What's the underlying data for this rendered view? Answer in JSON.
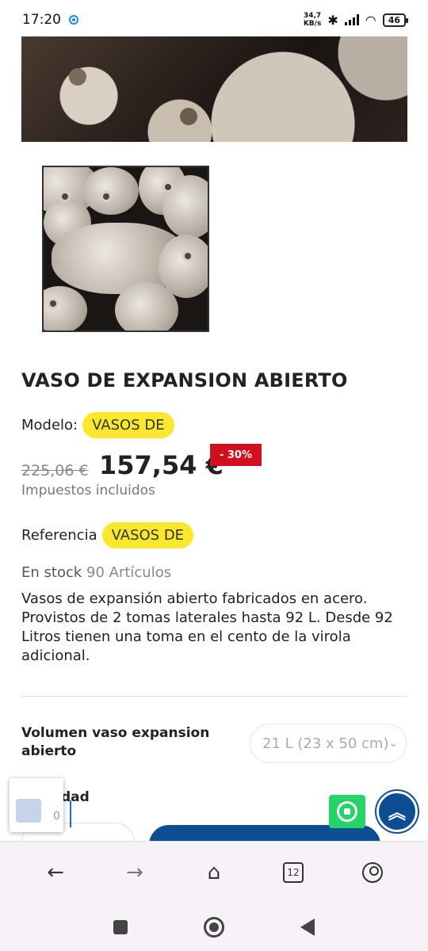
{
  "status_bar": {
    "time": "17:20",
    "net_speed_value": "34,7",
    "net_speed_unit": "KB/s",
    "battery": "46"
  },
  "product": {
    "title": "VASO DE EXPANSION ABIERTO",
    "model_label": "Modelo:",
    "model_value": "VASOS DE",
    "old_price": "225,06 €",
    "new_price": "157,54 €",
    "discount": "- 30%",
    "tax_note": "Impuestos incluidos",
    "reference_label": "Referencia",
    "reference_value": "VASOS DE",
    "stock_label": "En stock",
    "stock_count": "90 Artículos",
    "description": "Vasos de expansión abierto fabricados en acero. Provistos de 2 tomas laterales hasta 92 L. Desde 92 Litros tienen una toma en el cento de la virola adicional.",
    "variant_label": "Volumen vaso expansion abierto",
    "variant_selected": "21 L (23 x 50 cm)",
    "quantity_label": "Cantidad",
    "quantity_value": "0"
  },
  "browser": {
    "tab_count": "12"
  },
  "icons": {
    "back": "back-arrow-icon",
    "forward": "forward-arrow-icon",
    "home": "home-icon",
    "tabs": "tabs-icon",
    "profile": "profile-icon",
    "whatsapp": "whatsapp-icon",
    "scroll_top": "double-chevron-up-icon"
  },
  "colors": {
    "pill": "#fbe72d",
    "discount": "#d20f1d",
    "primary": "#0c4d94",
    "whatsapp": "#25d366"
  }
}
